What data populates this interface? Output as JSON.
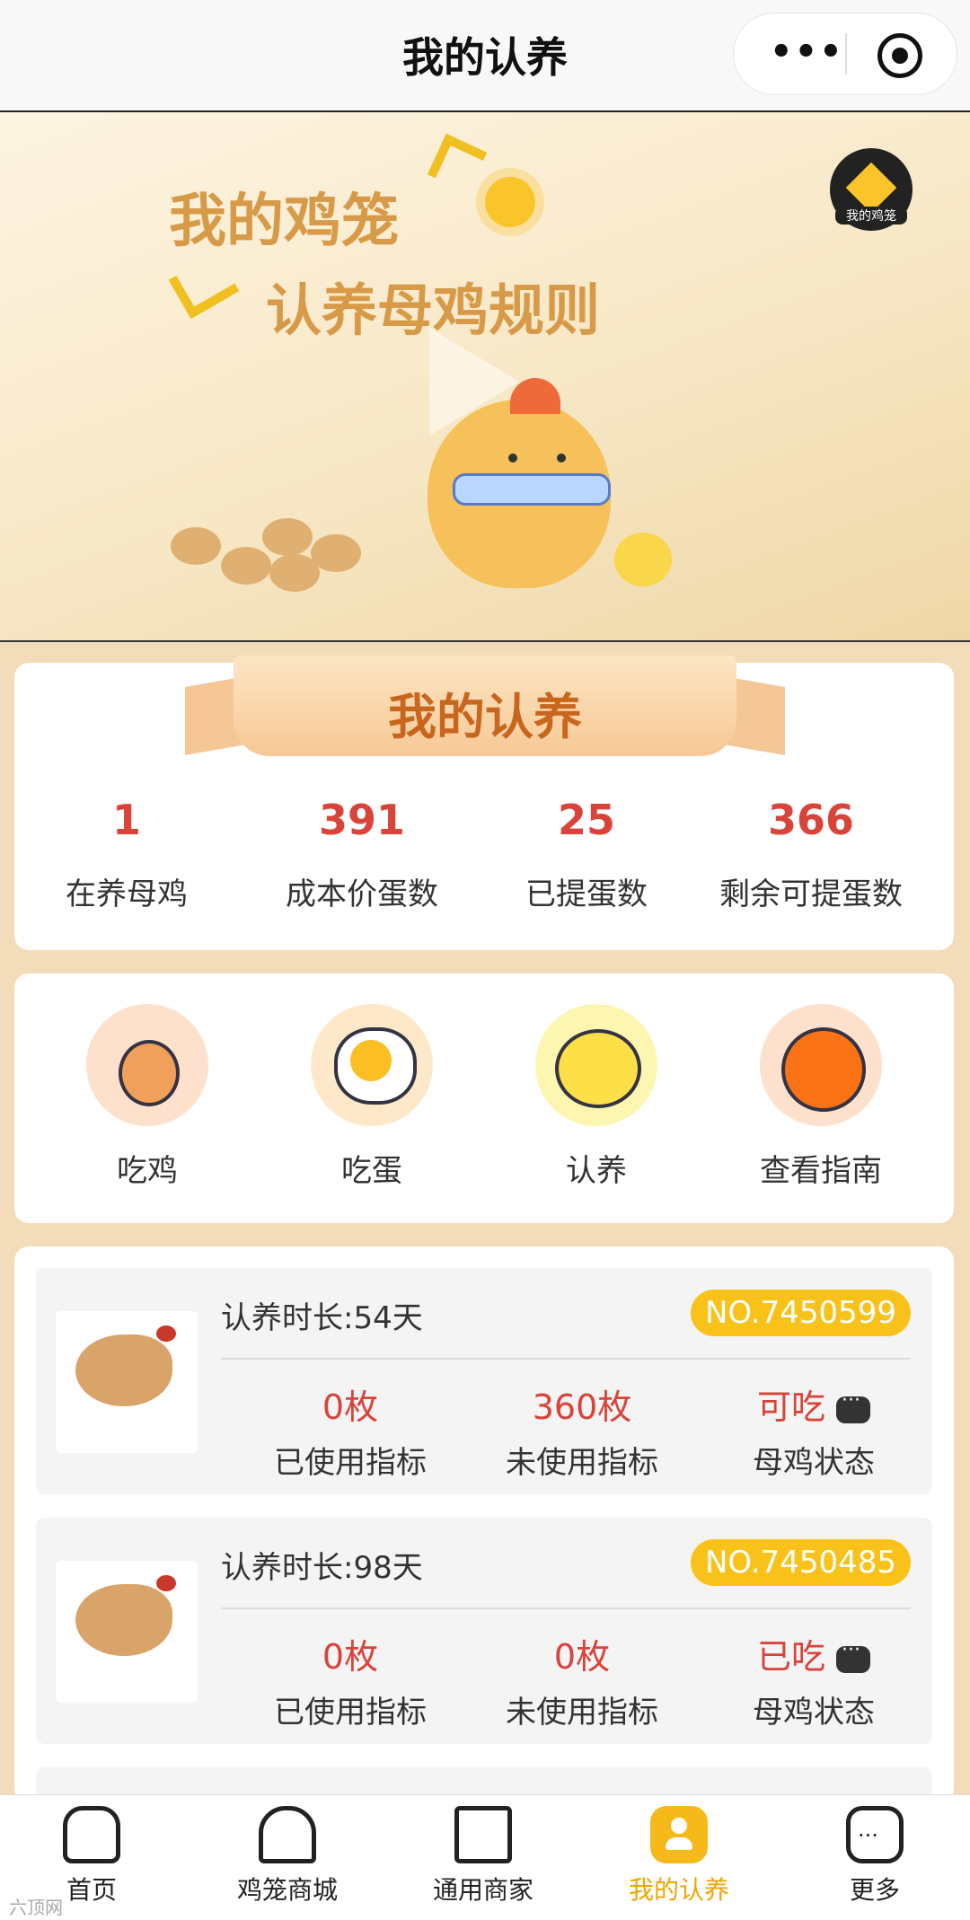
{
  "nav": {
    "title": "我的认养"
  },
  "banner": {
    "line1": "我的鸡笼",
    "line2": "认养母鸡规则",
    "logo_text": "我的鸡笼"
  },
  "summary": {
    "title": "我的认养",
    "stats": [
      {
        "value": "1",
        "label": "在养母鸡"
      },
      {
        "value": "391",
        "label": "成本价蛋数"
      },
      {
        "value": "25",
        "label": "已提蛋数"
      },
      {
        "value": "366",
        "label": "剩余可提蛋数"
      }
    ]
  },
  "menu": [
    {
      "label": "吃鸡",
      "icon": "drumstick-icon",
      "bg": "#fde1cc"
    },
    {
      "label": "吃蛋",
      "icon": "fried-egg-icon",
      "bg": "#fde9c9"
    },
    {
      "label": "认养",
      "icon": "chick-icon",
      "bg": "#fdf6b0"
    },
    {
      "label": "查看指南",
      "icon": "pumpkin-icon",
      "bg": "#fde1cc"
    }
  ],
  "records": [
    {
      "duration": "认养时长:54天",
      "no": "NO.7450599",
      "used": "0枚",
      "used_label": "已使用指标",
      "unused": "360枚",
      "unused_label": "未使用指标",
      "status": "可吃",
      "status_label": "母鸡状态"
    },
    {
      "duration": "认养时长:98天",
      "no": "NO.7450485",
      "used": "0枚",
      "used_label": "已使用指标",
      "unused": "0枚",
      "unused_label": "未使用指标",
      "status": "已吃",
      "status_label": "母鸡状态"
    }
  ],
  "tabs": [
    {
      "label": "首页",
      "icon": "home-icon"
    },
    {
      "label": "鸡笼商城",
      "icon": "store-icon"
    },
    {
      "label": "通用商家",
      "icon": "building-icon"
    },
    {
      "label": "我的认养",
      "icon": "profile-icon",
      "active": true
    },
    {
      "label": "更多",
      "icon": "more-icon"
    }
  ],
  "colors": {
    "accent": "#f9c21a",
    "value_red": "#d9433a",
    "page_bg": "#f3dcb9"
  },
  "watermark": "六顶网"
}
